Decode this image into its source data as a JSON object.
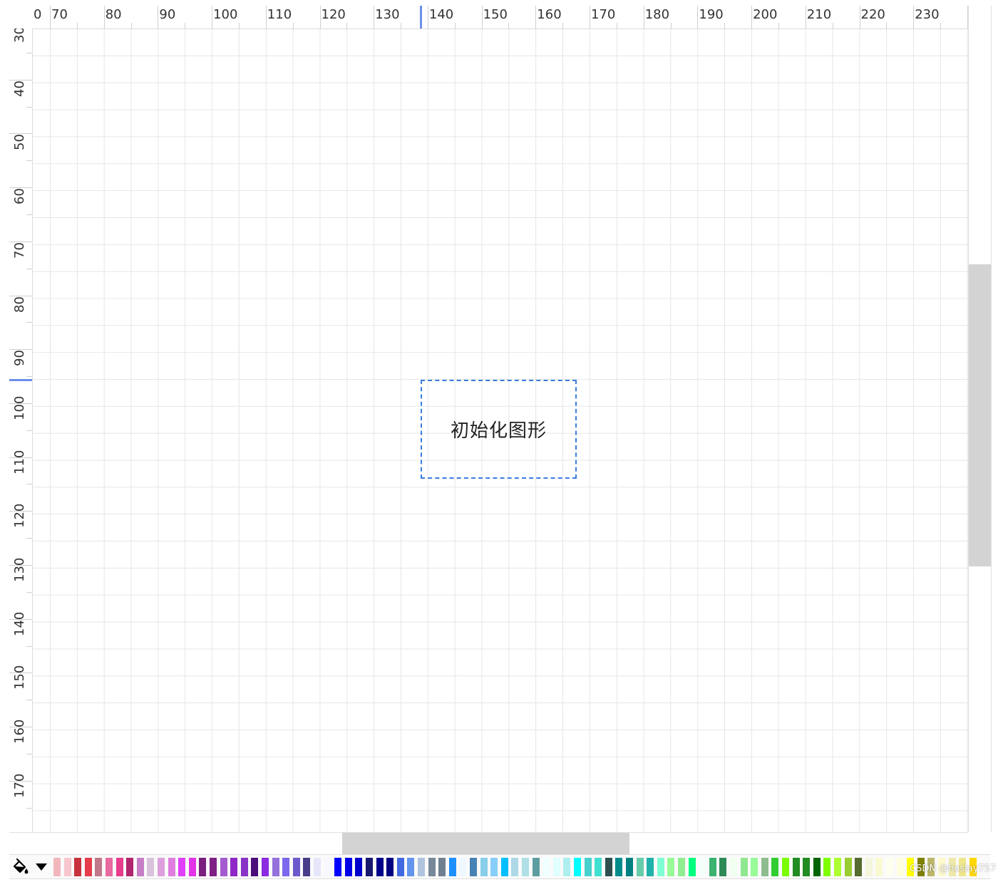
{
  "ruler_top": {
    "labels": [
      "0",
      "70",
      "80",
      "90",
      "100",
      "110",
      "120",
      "130",
      "140",
      "150",
      "160",
      "170",
      "180",
      "190",
      "200",
      "210",
      "220",
      "230"
    ]
  },
  "ruler_left": {
    "labels": [
      "30",
      "40",
      "50",
      "60",
      "70",
      "80",
      "90",
      "100",
      "110",
      "120",
      "130",
      "140",
      "150",
      "160",
      "170"
    ]
  },
  "shape": {
    "text": "初始化图形"
  },
  "palette": {
    "fill_icon": "paint-bucket-icon",
    "dropdown_icon": "caret-down-icon",
    "colors": [
      "#f2b6bd",
      "#f7c6cc",
      "#c8323c",
      "#e63c4b",
      "#c2788b",
      "#e86aa0",
      "#e83c8c",
      "#b0256e",
      "#c77ec6",
      "#d8c2dc",
      "#dda0dd",
      "#e07ee0",
      "#e040fb",
      "#e333e8",
      "#7b1f7f",
      "#7f1e85",
      "#a55bd0",
      "#8f27c8",
      "#8a34c7",
      "#4b0e7a",
      "#8a2be2",
      "#9370db",
      "#7b68ee",
      "#6a5acd",
      "#483d8b",
      "#e6e6fa",
      "#f8f8ff",
      "#0000ff",
      "#0000e6",
      "#0000cd",
      "#191970",
      "#00008b",
      "#000080",
      "#4169e1",
      "#6495ed",
      "#b0c4de",
      "#778899",
      "#708090",
      "#1e90ff",
      "#f0f8ff",
      "#4682b4",
      "#87ceeb",
      "#87cefa",
      "#00bfff",
      "#add8e6",
      "#b0e0e6",
      "#5f9ea0",
      "#f0ffff",
      "#e0ffff",
      "#afeeee",
      "#00ffff",
      "#48d1cc",
      "#40e0d0",
      "#2f4f4f",
      "#008b8b",
      "#008080",
      "#66cdaa",
      "#20b2aa",
      "#7fffd4",
      "#98fb98",
      "#90ee90",
      "#00ff7f",
      "#f5fffa",
      "#3cb371",
      "#2e8b57",
      "#f0fff0",
      "#8fe88f",
      "#98fb98",
      "#8fbc8f",
      "#32cd32",
      "#7cfc00",
      "#228b22",
      "#228b22",
      "#006400",
      "#7fff00",
      "#adff2f",
      "#9acd32",
      "#556b2f",
      "#f5f5dc",
      "#fafad2",
      "#fffff0",
      "#ffffe0",
      "#ffff00",
      "#808000",
      "#bdb76b",
      "#fffacd",
      "#eee8aa",
      "#f0e68c",
      "#ffd700"
    ]
  },
  "watermark": "CSDN @hoslay757"
}
